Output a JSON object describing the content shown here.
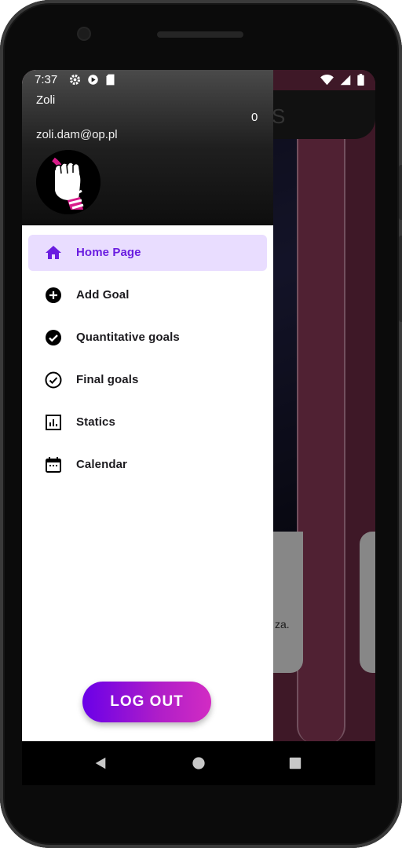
{
  "status_bar": {
    "time": "7:37",
    "icons_left": [
      "gear-icon",
      "play-protect-icon",
      "sd-card-icon"
    ],
    "icons_right": [
      "wifi-icon",
      "signal-icon",
      "battery-icon"
    ]
  },
  "drawer": {
    "user_name": "Zoli",
    "user_email": "zoli.dam@op.pl",
    "counter": "0",
    "avatar_icon": "raised-fist-icon",
    "menu": [
      {
        "label": "Home Page",
        "icon": "home-icon",
        "active": true
      },
      {
        "label": "Add Goal",
        "icon": "add-circle-icon",
        "active": false
      },
      {
        "label": "Quantitative goals",
        "icon": "check-circle-filled-icon",
        "active": false
      },
      {
        "label": "Final goals",
        "icon": "check-circle-outline-icon",
        "active": false
      },
      {
        "label": "Statics",
        "icon": "bar-chart-icon",
        "active": false
      },
      {
        "label": "Calendar",
        "icon": "calendar-icon",
        "active": false
      }
    ],
    "logout_label": "LOG OUT"
  },
  "background": {
    "title_fragment": "S",
    "card_text_fragment": "za."
  },
  "nav_bar": {
    "buttons": [
      "back-icon",
      "home-button-icon",
      "recents-icon"
    ]
  },
  "colors": {
    "accent": "#6a1de0",
    "active_bg": "#e9ddff",
    "logout_gradient_start": "#6a00e8",
    "logout_gradient_end": "#d22cc3"
  }
}
